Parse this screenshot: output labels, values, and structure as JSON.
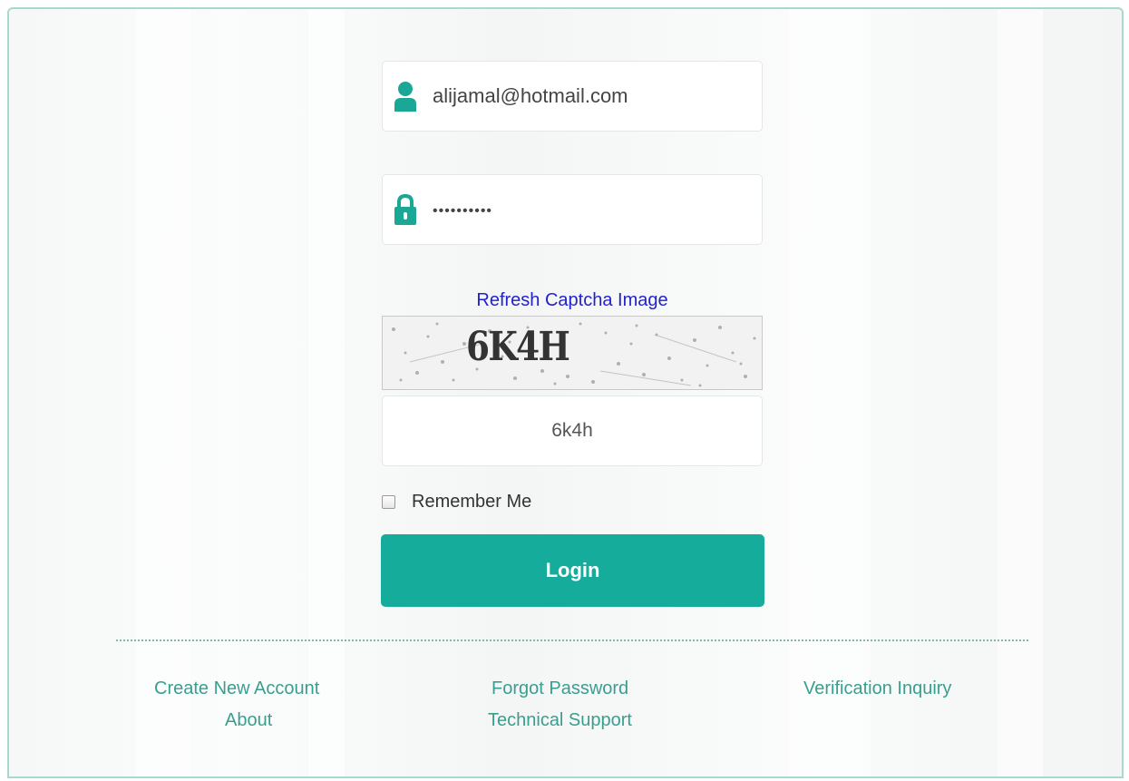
{
  "login_form": {
    "username_value": "alijamal@hotmail.com",
    "password_masked": "••••••••••",
    "refresh_captcha_label": "Refresh Captcha Image",
    "captcha_text": "6K4H",
    "captcha_input_value": "6k4h",
    "remember_me_label": "Remember Me",
    "remember_me_checked": false,
    "login_button_label": "Login"
  },
  "footer_links": {
    "create_account": "Create New Account",
    "about": "About",
    "forgot_password": "Forgot Password",
    "technical_support": "Technical Support",
    "verification_inquiry": "Verification Inquiry"
  },
  "colors": {
    "accent": "#16ac9c",
    "icon": "#1aa796",
    "link_blue": "#2222cc",
    "footer_link": "#3a9e8f",
    "frame_border": "#a9d8d1"
  },
  "icons": {
    "username": "user-icon",
    "password": "lock-icon"
  }
}
